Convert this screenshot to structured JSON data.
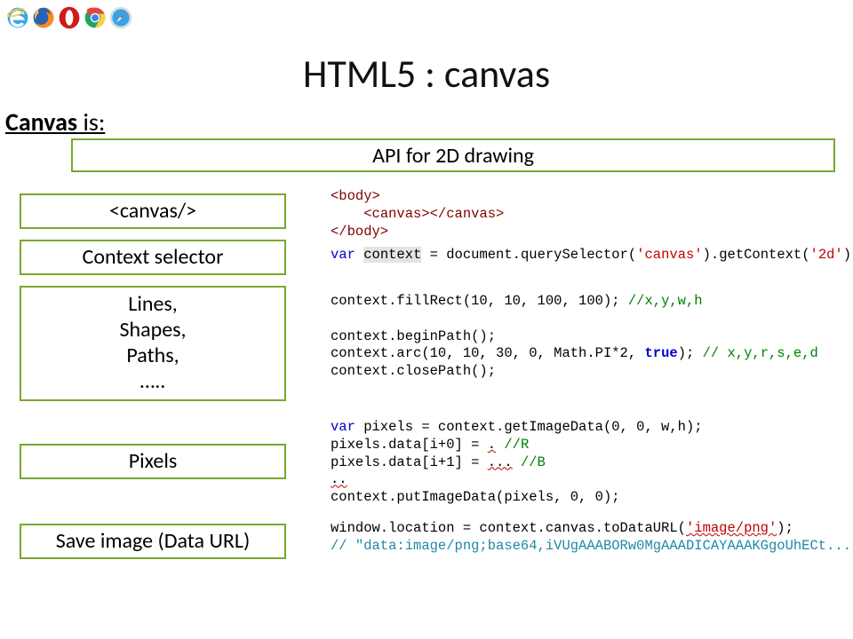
{
  "title": "HTML5 : canvas",
  "subheading_bold": "Canvas",
  "subheading_rest": " is:",
  "api_box": "API for 2D drawing",
  "features": {
    "canvas_tag": "<canvas/>",
    "context": "Context selector",
    "primitives_l1": "Lines,",
    "primitives_l2": "Shapes,",
    "primitives_l3": "Paths,",
    "primitives_l4": "…..",
    "pixels": "Pixels",
    "save": "Save image (Data URL)"
  },
  "code": {
    "c1_l1a": "<body>",
    "c1_l2a": "    ",
    "c1_l2b": "<canvas></canvas>",
    "c1_l3a": "</body>",
    "c2_kw": "var",
    "c2_var": "context",
    "c2_mid": " = document.querySelector(",
    "c2_str": "'canvas'",
    "c2_mid2": ").getContext(",
    "c2_str2": "'2d'",
    "c2_end": ");",
    "c3_l1": "context.fillRect(10, 10, 100, 100); ",
    "c3_l1_cmt": "//x,y,w,h",
    "c3_l3": "context.beginPath();",
    "c3_l4a": "context.arc(10, 10, 30, 0, Math.PI*2, ",
    "c3_l4_true": "true",
    "c3_l4b": "); ",
    "c3_l4_cmt": "// x,y,r,s,e,d",
    "c3_l5": "context.closePath();",
    "c4_kw": "var",
    "c4_l1": " pixels = context.getImageData(0, 0, w,h);",
    "c4_l2a": "pixels.data[i+0] = ",
    "c4_l2b": ".",
    "c4_l2_cmt": " //R",
    "c4_l3a": "pixels.data[i+1] = ",
    "c4_l3b": "...",
    "c4_l3_cmt": " //B",
    "c4_l4": "..",
    "c4_l5": "context.putImageData(pixels, 0, 0);",
    "c5_l1a": "window.location = context.canvas.toDataURL(",
    "c5_l1_str": "'image/png'",
    "c5_l1b": ");",
    "c5_l2_cmt": "// \"data:image/png;base64,iVUgAAABORw0MgAAADICAYAAAKGgoUhECt...\""
  },
  "icons": {
    "ie": "ie-icon",
    "firefox": "firefox-icon",
    "opera": "opera-icon",
    "chrome": "chrome-icon",
    "safari": "safari-icon"
  }
}
